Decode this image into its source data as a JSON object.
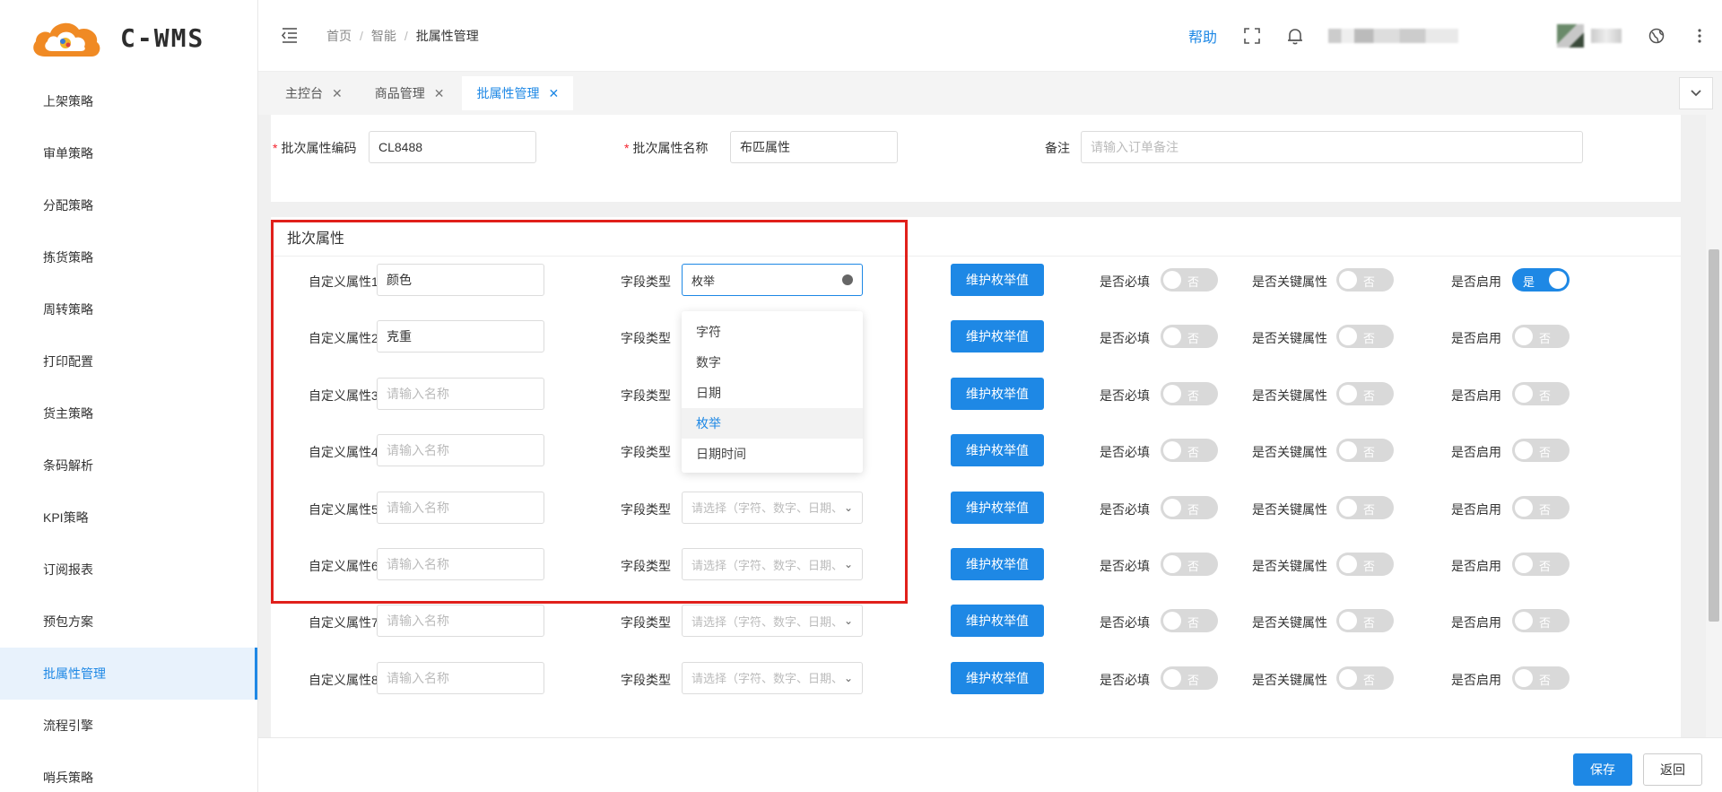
{
  "app": {
    "logo_text": "C-WMS"
  },
  "colors": {
    "accent": "#1e88e5",
    "highlight": "#e0201b",
    "switch_off": "#d9d9d9"
  },
  "sidebar": {
    "items": [
      {
        "label": "上架策略"
      },
      {
        "label": "审单策略"
      },
      {
        "label": "分配策略"
      },
      {
        "label": "拣货策略"
      },
      {
        "label": "周转策略"
      },
      {
        "label": "打印配置"
      },
      {
        "label": "货主策略"
      },
      {
        "label": "条码解析"
      },
      {
        "label": "KPI策略"
      },
      {
        "label": "订阅报表"
      },
      {
        "label": "预包方案"
      },
      {
        "label": "批属性管理",
        "active": true
      },
      {
        "label": "流程引擎"
      },
      {
        "label": "哨兵策略"
      }
    ]
  },
  "header": {
    "breadcrumb": [
      "首页",
      "智能",
      "批属性管理"
    ],
    "help": "帮助",
    "icons": [
      "collapse-icon",
      "fullscreen-icon",
      "bell-icon",
      "globe-icon",
      "more-icon"
    ]
  },
  "tabs": [
    {
      "label": "主控台"
    },
    {
      "label": "商品管理"
    },
    {
      "label": "批属性管理",
      "active": true
    }
  ],
  "form": {
    "code_label": "批次属性编码",
    "code_value": "CL8488",
    "name_label": "批次属性名称",
    "name_value": "布匹属性",
    "remark_label": "备注",
    "remark_placeholder": "请输入订单备注"
  },
  "attributes": {
    "title": "批次属性",
    "field_type_label": "字段类型",
    "enum_button": "维护枚举值",
    "required_label": "是否必填",
    "key_label": "是否关键属性",
    "enabled_label": "是否启用",
    "name_placeholder": "请输入名称",
    "type_placeholder": "请选择（字符、数字、日期、",
    "on_text": "是",
    "off_text": "否",
    "rows": [
      {
        "label": "自定义属性1",
        "name": "颜色",
        "type": "枚举",
        "required": false,
        "key": false,
        "enabled": true
      },
      {
        "label": "自定义属性2",
        "name": "克重",
        "type": "",
        "required": false,
        "key": false,
        "enabled": false
      },
      {
        "label": "自定义属性3",
        "name": "",
        "type": "",
        "required": false,
        "key": false,
        "enabled": false
      },
      {
        "label": "自定义属性4",
        "name": "",
        "type": "",
        "required": false,
        "key": false,
        "enabled": false
      },
      {
        "label": "自定义属性5",
        "name": "",
        "type": "",
        "required": false,
        "key": false,
        "enabled": false
      },
      {
        "label": "自定义属性6",
        "name": "",
        "type": "",
        "required": false,
        "key": false,
        "enabled": false
      },
      {
        "label": "自定义属性7",
        "name": "",
        "type": "",
        "required": false,
        "key": false,
        "enabled": false
      },
      {
        "label": "自定义属性8",
        "name": "",
        "type": "",
        "required": false,
        "key": false,
        "enabled": false
      }
    ],
    "dropdown_options": [
      "字符",
      "数字",
      "日期",
      "枚举",
      "日期时间"
    ],
    "dropdown_selected": "枚举"
  },
  "footer": {
    "save": "保存",
    "back": "返回"
  }
}
